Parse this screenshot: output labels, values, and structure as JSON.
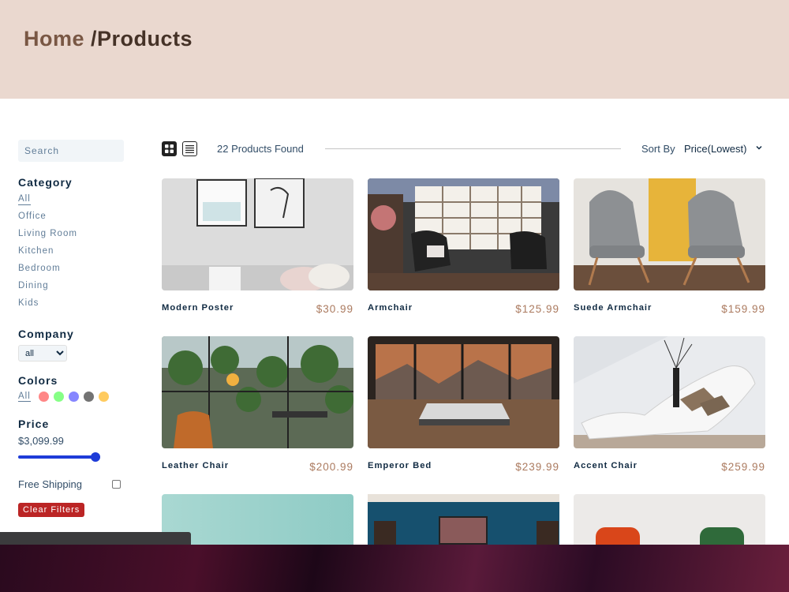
{
  "hero": {
    "home": "Home",
    "separator": " /",
    "current": "Products"
  },
  "sidebar": {
    "search_placeholder": "Search",
    "category_heading": "Category",
    "categories": [
      "All",
      "Office",
      "Living Room",
      "Kitchen",
      "Bedroom",
      "Dining",
      "Kids"
    ],
    "company_heading": "Company",
    "company_selected": "all",
    "colors_heading": "Colors",
    "colors_all": "All",
    "colors": [
      "#ff5e5e",
      "#5eff5e",
      "#5e5eff",
      "#444444",
      "#ffb929"
    ],
    "price_heading": "Price",
    "price_value": "$3,099.99",
    "price_fraction": 0.94,
    "free_shipping": "Free Shipping",
    "clear_filters": "Clear Filters"
  },
  "toolbar": {
    "count": "22 Products Found",
    "sort_label": "Sort By",
    "sort_value": "Price(Lowest)"
  },
  "products": [
    {
      "name": "Modern Poster",
      "price": "$30.99",
      "image": "poster-room"
    },
    {
      "name": "Armchair",
      "price": "$125.99",
      "image": "armchair-shelves"
    },
    {
      "name": "Suede Armchair",
      "price": "$159.99",
      "image": "grey-chairs"
    },
    {
      "name": "Leather Chair",
      "price": "$200.99",
      "image": "plants-chair"
    },
    {
      "name": "Emperor Bed",
      "price": "$239.99",
      "image": "bed-window"
    },
    {
      "name": "Accent Chair",
      "price": "$259.99",
      "image": "white-lounge"
    }
  ],
  "colors": {
    "accent": "#ab7a5f",
    "slider": "#1e3cd8",
    "clear": "#bb2525"
  }
}
